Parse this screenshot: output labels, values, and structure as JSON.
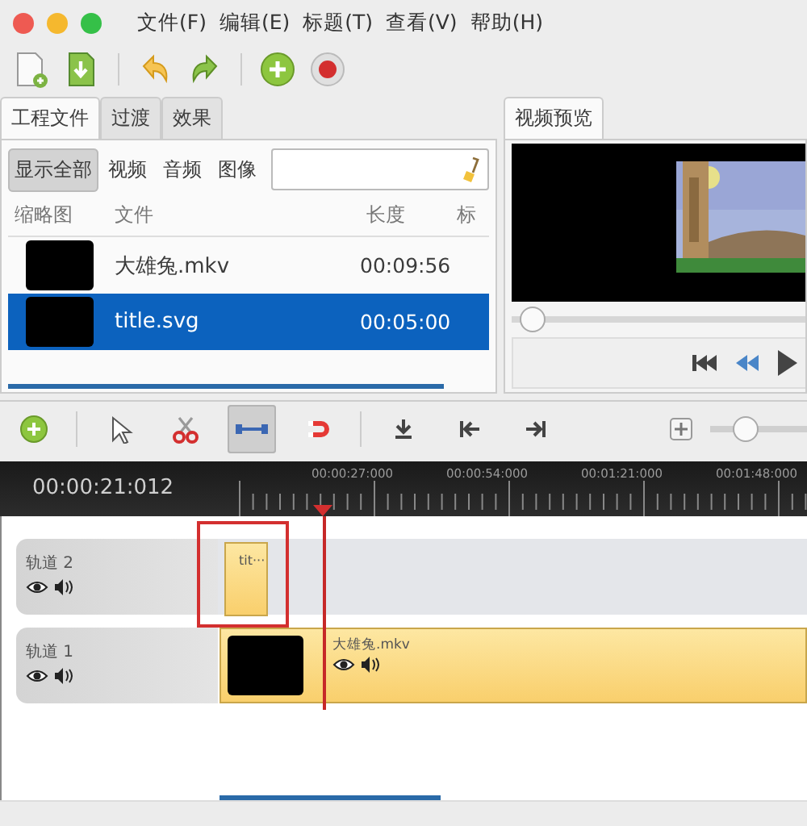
{
  "menu": [
    "文件(F)",
    "编辑(E)",
    "标题(T)",
    "查看(V)",
    "帮助(H)"
  ],
  "project_panel": {
    "tabs": [
      {
        "label": "工程文件",
        "selected": true
      },
      {
        "label": "过渡",
        "selected": false
      },
      {
        "label": "效果",
        "selected": false
      }
    ],
    "filters": [
      {
        "label": "显示全部",
        "selected": true
      },
      {
        "label": "视频",
        "selected": false
      },
      {
        "label": "音频",
        "selected": false
      },
      {
        "label": "图像",
        "selected": false
      }
    ],
    "columns": [
      "缩略图",
      "文件",
      "长度",
      "标"
    ],
    "files": [
      {
        "name": "大雄兔.mkv",
        "length": "00:09:56",
        "selected": false
      },
      {
        "name": "title.svg",
        "length": "00:05:00",
        "selected": true
      }
    ]
  },
  "preview": {
    "tab": "视频预览",
    "level": 0.05
  },
  "timeline": {
    "tools": [
      {
        "kind": "add-track",
        "selected": false
      },
      {
        "kind": "pointer",
        "selected": false
      },
      {
        "kind": "razor",
        "selected": false
      },
      {
        "kind": "snap",
        "selected": true
      },
      {
        "kind": "magnet",
        "selected": false
      },
      {
        "kind": "marker",
        "selected": false
      },
      {
        "kind": "prev",
        "selected": false
      },
      {
        "kind": "next",
        "selected": false
      }
    ],
    "zoom": {
      "level": 0.35
    },
    "current_time": "00:00:21:012",
    "ticks": [
      "00:00:27:000",
      "00:00:54:000",
      "00:01:21:000",
      "00:01:48:000"
    ],
    "tracks": [
      {
        "name": "轨道 2",
        "clips": [
          {
            "kind": "title",
            "label": "tit···"
          }
        ]
      },
      {
        "name": "轨道 1",
        "clips": [
          {
            "kind": "video",
            "label": "大雄兔.mkv"
          }
        ]
      }
    ]
  }
}
